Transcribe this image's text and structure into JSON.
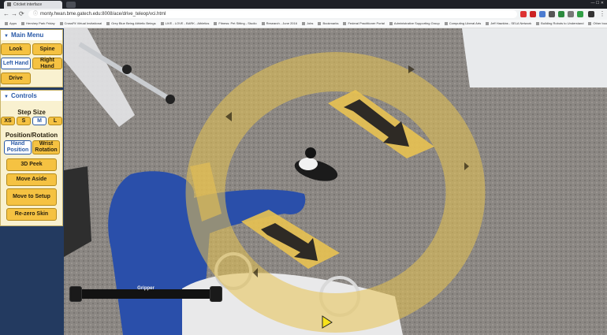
{
  "browser": {
    "tab_title": "Cricket interface",
    "url": "monty.hwan.bme.gatech.edu:8008/ace/drive_teleop/vci.html",
    "bookmarks": [
      "Apps",
      "Hershey Park Friday",
      "CrossFit Virtual Invitational",
      "Grey Blue Being Athletic Beings",
      "LIVE - LOVE - BARK - Athletics",
      "Fitness: Pet Sitting - Studio",
      "Research - June 2016",
      "Jobs",
      "Bookmarks",
      "Federal Practitioner Portal",
      "Administrative Supporting Group",
      "Computing Liberal Arts",
      "Jeff Hawkins - SELA Network",
      "Building Robots to Understand",
      "Other bookmarks"
    ]
  },
  "main_menu": {
    "title": "Main Menu",
    "buttons": {
      "look": "Look",
      "spine": "Spine",
      "left_hand": "Left Hand",
      "right_hand": "Right Hand",
      "drive": "Drive"
    }
  },
  "controls": {
    "title": "Controls",
    "step_size_label": "Step Size",
    "step_sizes": [
      "XS",
      "S",
      "M",
      "L"
    ],
    "selected_step": "M",
    "position_rotation_label": "Position/Rotation",
    "hand_position": "Hand Position",
    "wrist_rotation": "Wrist Rotation",
    "peek": "3D Peek",
    "move_aside": "Move Aside",
    "move_to_setup": "Move to Setup",
    "rezero": "Re-zero Skin"
  },
  "gripper": {
    "label": "Gripper"
  },
  "colors": {
    "button": "#f5c242",
    "selected": "#2a5aa8",
    "ring": "#e8c251",
    "sidebar": "#233a60"
  }
}
